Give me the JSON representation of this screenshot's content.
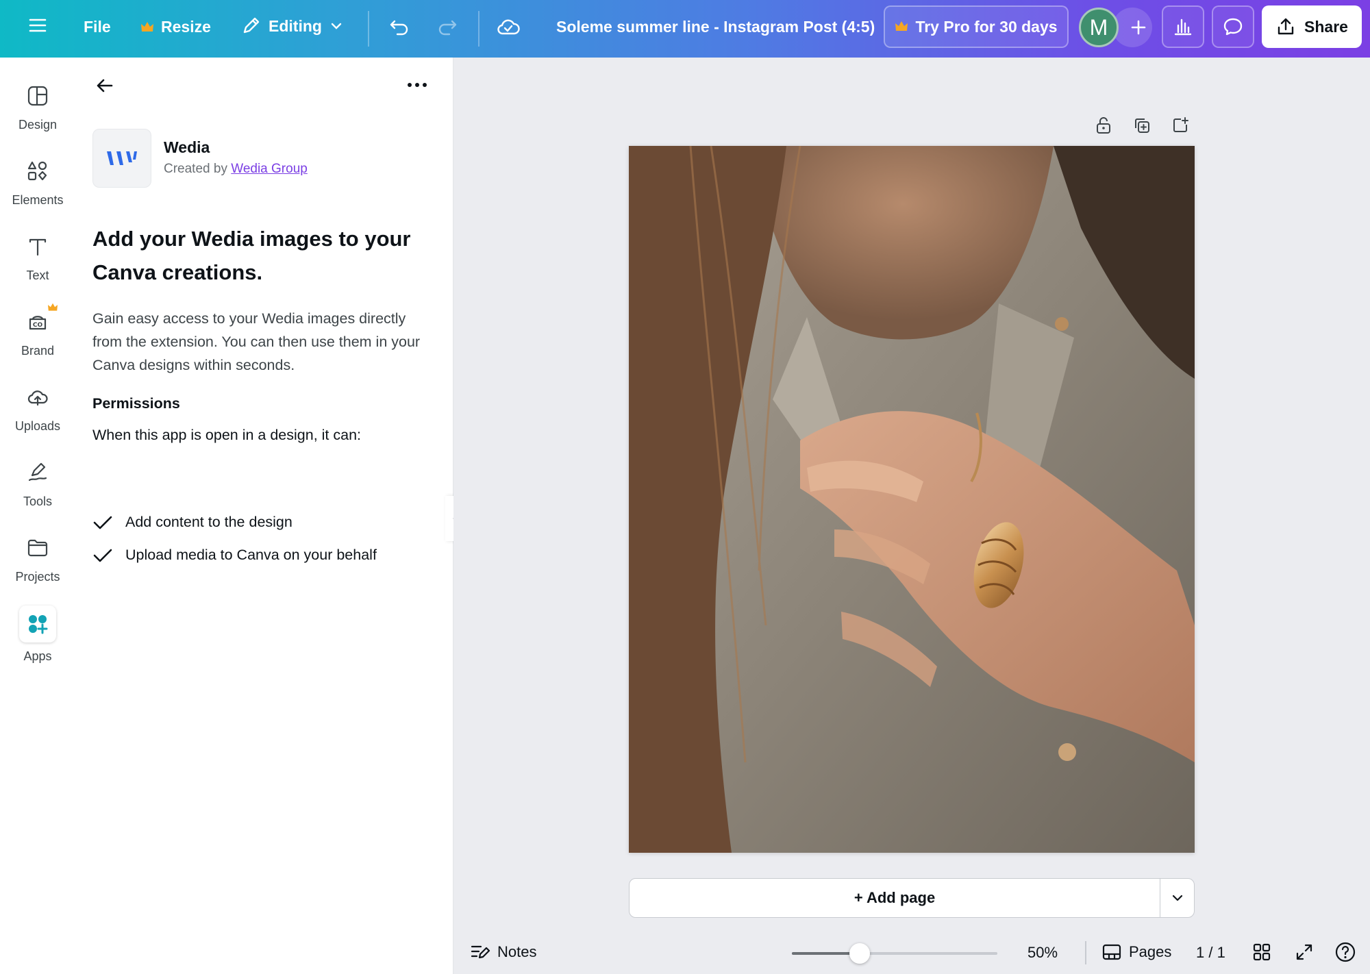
{
  "topbar": {
    "file_label": "File",
    "resize_label": "Resize",
    "editing_label": "Editing",
    "design_title": "Soleme summer line - Instagram Post (4:5)",
    "pro_label": "Try Pro for 30 days",
    "avatar_initial": "M",
    "share_label": "Share"
  },
  "rail": {
    "items": [
      {
        "label": "Design",
        "icon": "design-icon"
      },
      {
        "label": "Elements",
        "icon": "elements-icon"
      },
      {
        "label": "Text",
        "icon": "text-icon"
      },
      {
        "label": "Brand",
        "icon": "brand-icon"
      },
      {
        "label": "Uploads",
        "icon": "uploads-icon"
      },
      {
        "label": "Tools",
        "icon": "tools-icon"
      },
      {
        "label": "Projects",
        "icon": "projects-icon"
      },
      {
        "label": "Apps",
        "icon": "apps-icon"
      }
    ]
  },
  "panel": {
    "app_name": "Wedia",
    "created_by_prefix": "Created by",
    "creator": "Wedia Group",
    "heading": "Add your Wedia images to your Canva creations.",
    "description": "Gain easy access to your Wedia images directly from the extension. You can then use them in your Canva designs within seconds.",
    "permissions_title": "Permissions",
    "permissions_intro": "When this app is open in a design, it can:",
    "permissions": [
      "Add content to the design",
      "Upload media to Canva on your behalf"
    ]
  },
  "canvas": {
    "add_page_label": "+ Add page",
    "image_description": "photo"
  },
  "bottombar": {
    "notes_label": "Notes",
    "zoom_label": "50%",
    "zoom_fraction": 0.33,
    "pages_label": "Pages",
    "page_counter": "1 / 1"
  },
  "colors": {
    "accent": "#7b3fe4",
    "topbar_start": "#0fb9c6",
    "topbar_end": "#7b3fe4",
    "crown": "#f5a623",
    "wedia_blue": "#2f6ae8"
  }
}
